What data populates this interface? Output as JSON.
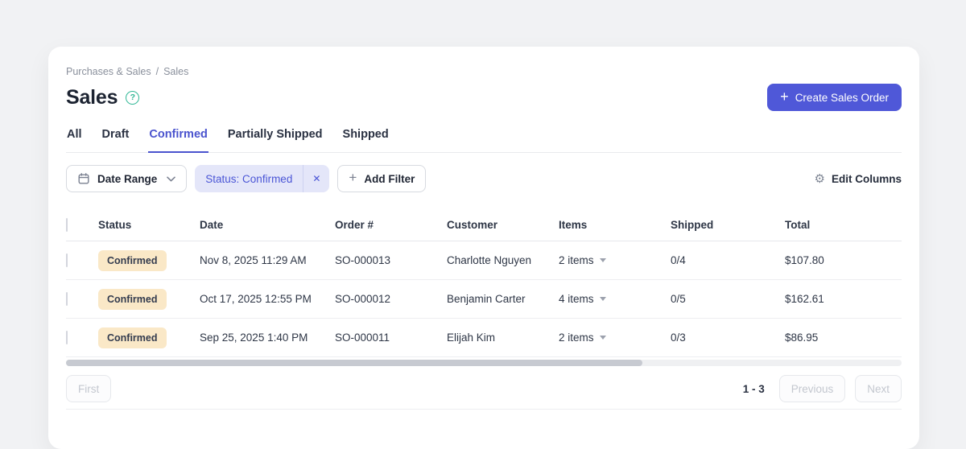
{
  "colors": {
    "page_bg": "#F1F2F4",
    "card_bg": "#FFFFFF",
    "accent_indigo": "#4F58D8",
    "active_tab": "#4A53CE",
    "chip_bg": "#E4E6F9",
    "chip_text": "#4A55D6",
    "badge_bg": "#FAE8C7",
    "badge_text": "#333B4E",
    "help_teal": "#30B795"
  },
  "breadcrumb": {
    "parent": "Purchases & Sales",
    "separator": "/",
    "current": "Sales"
  },
  "page": {
    "title": "Sales"
  },
  "create_button": {
    "label": "Create Sales Order"
  },
  "tabs": [
    {
      "label": "All",
      "active": false
    },
    {
      "label": "Draft",
      "active": false
    },
    {
      "label": "Confirmed",
      "active": true
    },
    {
      "label": "Partially Shipped",
      "active": false
    },
    {
      "label": "Shipped",
      "active": false
    }
  ],
  "filters": {
    "date_range_label": "Date Range",
    "status_chip_label": "Status: Confirmed",
    "add_filter_label": "Add Filter",
    "edit_columns_label": "Edit Columns"
  },
  "icons": {
    "help": "?",
    "plus": "+",
    "close": "✕",
    "gear": "⚙"
  },
  "table": {
    "columns": [
      "Status",
      "Date",
      "Order #",
      "Customer",
      "Items",
      "Shipped",
      "Total"
    ],
    "rows": [
      {
        "status": "Confirmed",
        "date": "Nov 8, 2025 11:29 AM",
        "order": "SO-000013",
        "customer": "Charlotte Nguyen",
        "items": "2 items",
        "shipped": "0/4",
        "total": "$107.80"
      },
      {
        "status": "Confirmed",
        "date": "Oct 17, 2025 12:55 PM",
        "order": "SO-000012",
        "customer": "Benjamin Carter",
        "items": "4 items",
        "shipped": "0/5",
        "total": "$162.61"
      },
      {
        "status": "Confirmed",
        "date": "Sep 25, 2025 1:40 PM",
        "order": "SO-000011",
        "customer": "Elijah Kim",
        "items": "2 items",
        "shipped": "0/3",
        "total": "$86.95"
      }
    ]
  },
  "pagination": {
    "first": "First",
    "range": "1 - 3",
    "previous": "Previous",
    "next": "Next"
  }
}
